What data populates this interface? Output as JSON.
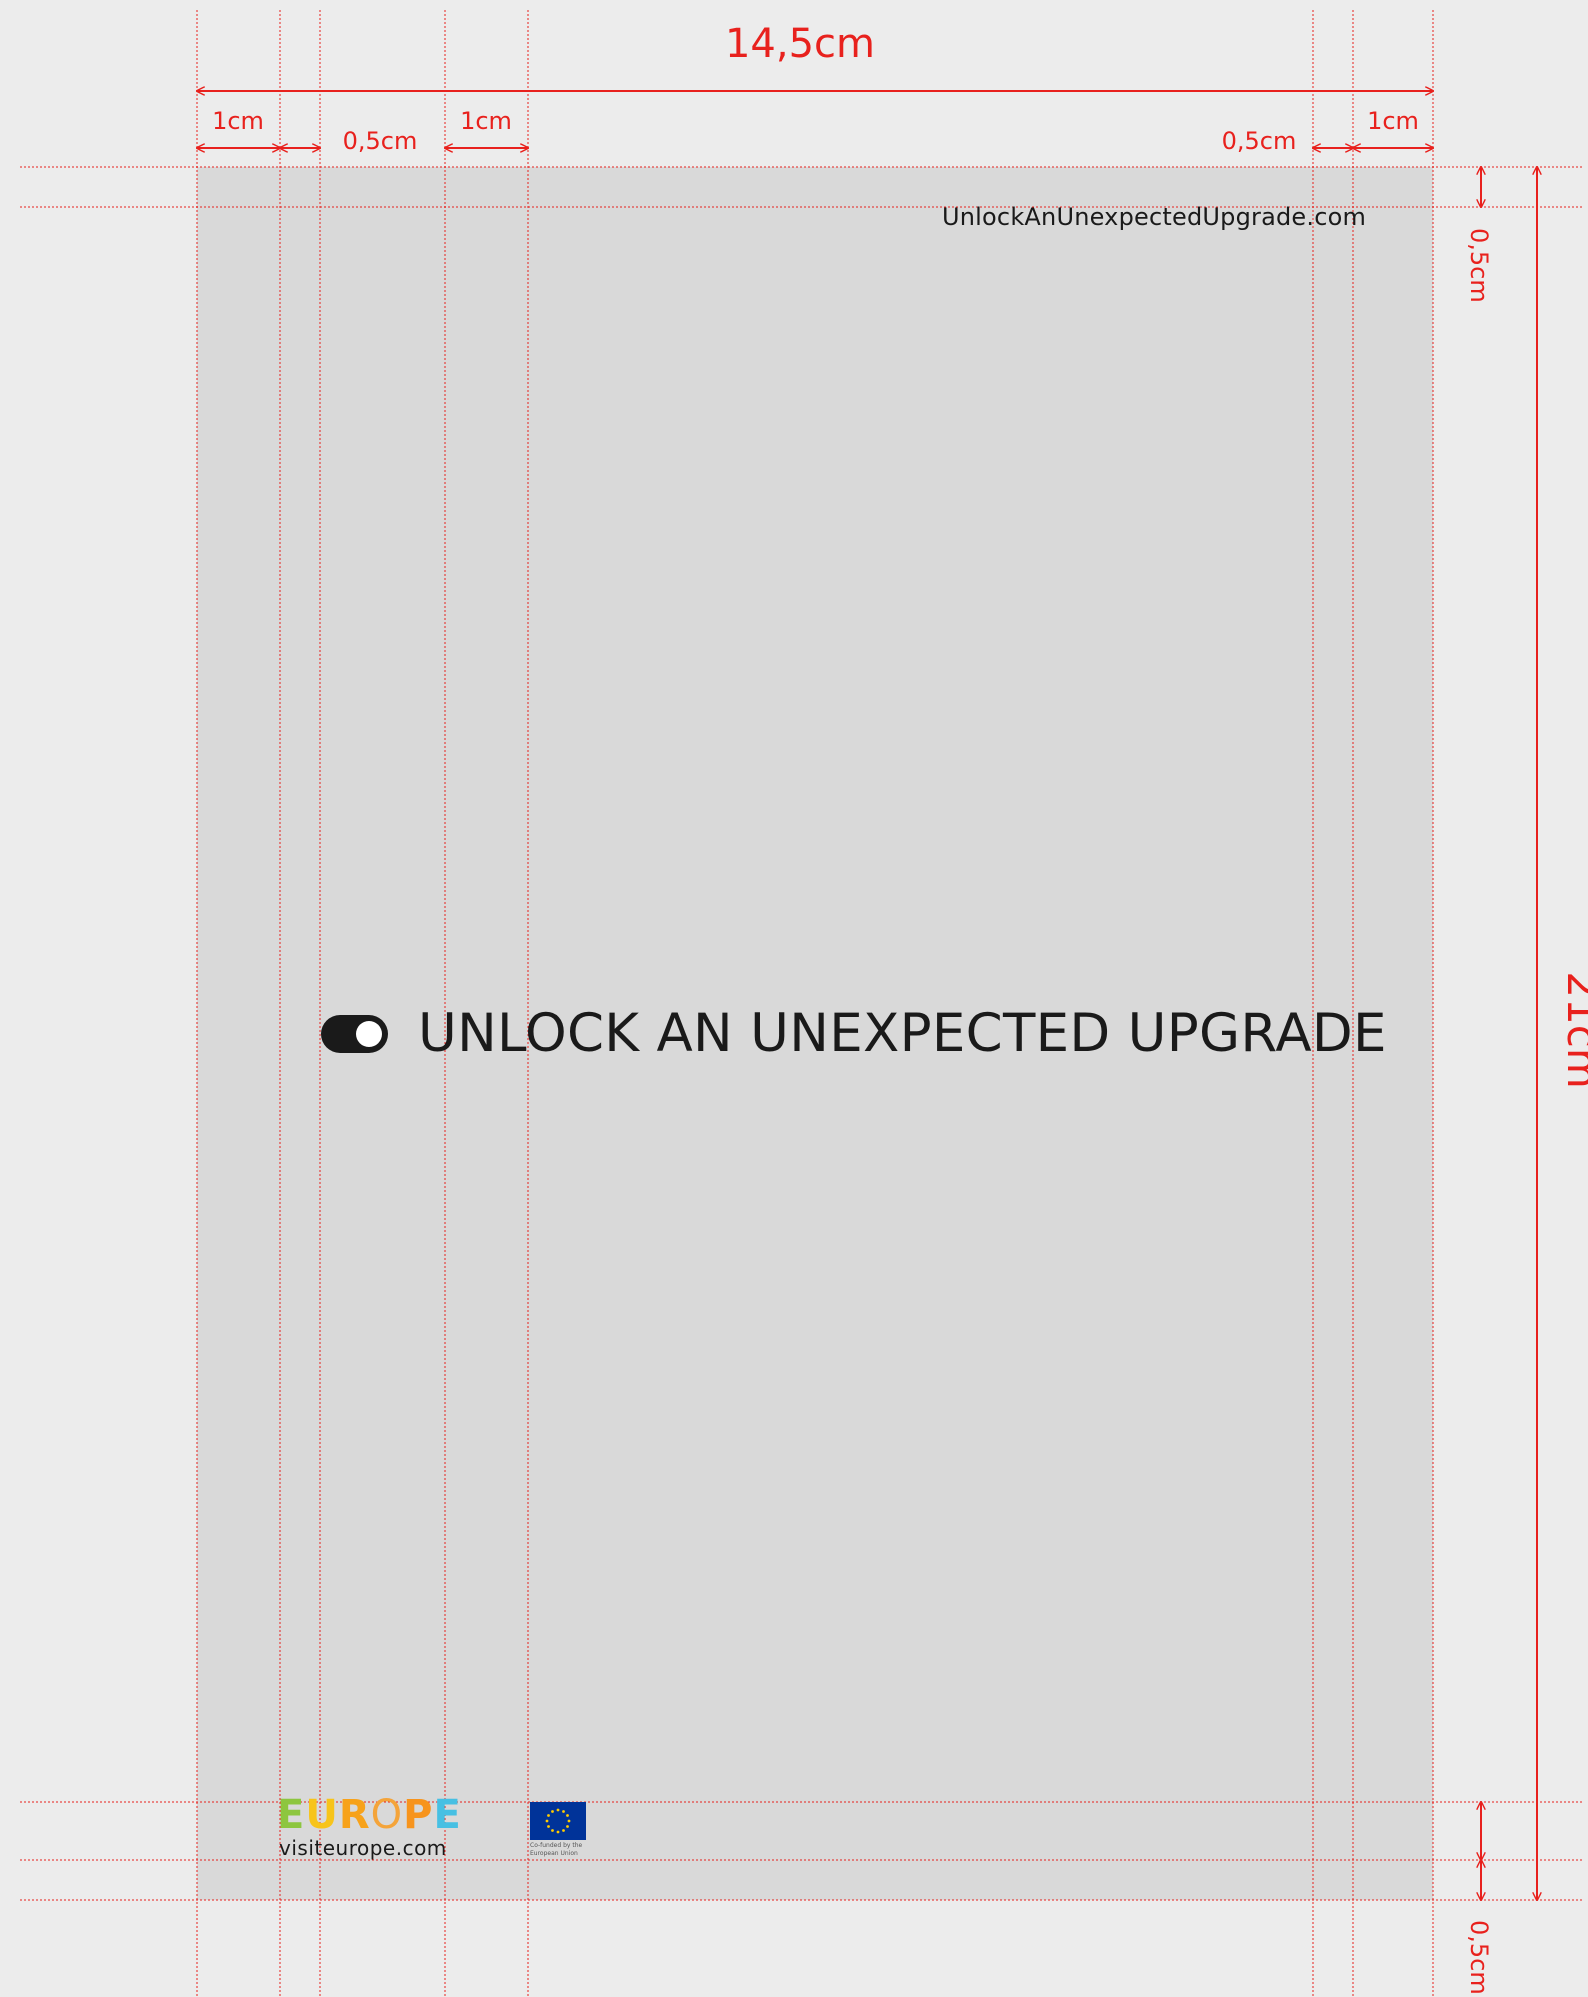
{
  "dimensions": {
    "total_width": "14,5cm",
    "total_height": "21cm",
    "left_outer_margin": "1cm",
    "left_gap": "0,5cm",
    "left_inner_margin": "1cm",
    "right_gap": "0,5cm",
    "right_outer_margin": "1cm",
    "top_margin": "0,5cm",
    "bottom_margin": "0,5cm"
  },
  "artwork": {
    "site_url": "UnlockAnUnexpectedUpgrade.com",
    "headline": "UNLOCK AN UNEXPECTED UPGRADE",
    "toggle_state": "on",
    "europe_logo": {
      "letters": [
        "E",
        "U",
        "R",
        "O",
        "P",
        "E"
      ],
      "letter_colors": [
        "#8dc63f",
        "#f7c41a",
        "#f7a21a",
        "#f4a43a",
        "#f7941d",
        "#47c0e3"
      ],
      "url": "visiteurope.com"
    },
    "eu_emblem": {
      "caption": "Co-funded by the European Union",
      "flag_color": "#003399",
      "star_color": "#ffcc00"
    }
  },
  "colors": {
    "dimension_lines": "#e8211d",
    "background": "#ececec",
    "artboard": "#d9d9d9",
    "text": "#1a1a1a"
  }
}
